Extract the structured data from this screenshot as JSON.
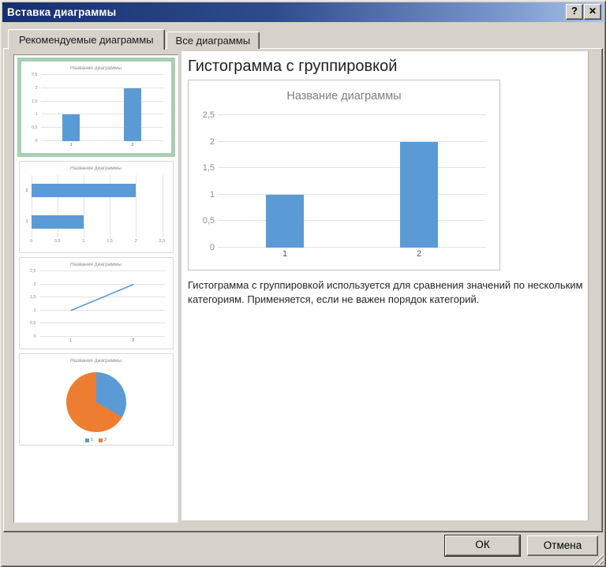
{
  "window": {
    "title": "Вставка диаграммы",
    "help_glyph": "?",
    "close_glyph": "✕"
  },
  "tabs": [
    {
      "id": "recommended",
      "label": "Рекомендуемые диаграммы",
      "active": true
    },
    {
      "id": "all",
      "label": "Все диаграммы",
      "active": false
    }
  ],
  "main": {
    "heading": "Гистограмма с группировкой",
    "description": "Гистограмма с группировкой используется для сравнения значений по нескольким категориям. Применяется, если не важен порядок категорий."
  },
  "footer": {
    "ok": "ОК",
    "cancel": "Отмена"
  },
  "colors": {
    "bar_blue": "#5B9BD5",
    "pie_orange": "#ED7D31",
    "selection_green": "#A6CFB4"
  },
  "chart_data": [
    {
      "id": "preview",
      "type": "bar",
      "title": "Название диаграммы",
      "categories": [
        "1",
        "2"
      ],
      "values": [
        1,
        2
      ],
      "ylim": [
        0,
        2.5
      ],
      "yticks": [
        "0",
        "0,5",
        "1",
        "1,5",
        "2",
        "2,5"
      ],
      "grid": true,
      "bar_color": "#5B9BD5"
    },
    {
      "id": "thumb-column",
      "type": "bar",
      "title": "Название диаграммы",
      "categories": [
        "1",
        "2"
      ],
      "values": [
        1,
        2
      ],
      "ylim": [
        0,
        2.5
      ],
      "yticks": [
        "0",
        "0,5",
        "1",
        "1,5",
        "2",
        "2,5"
      ],
      "grid": true,
      "bar_color": "#5B9BD5"
    },
    {
      "id": "thumb-bar",
      "type": "bar-horizontal",
      "title": "Название диаграммы",
      "categories": [
        "1",
        "2"
      ],
      "values": [
        1,
        2
      ],
      "xlim": [
        0,
        2.5
      ],
      "xticks": [
        "0",
        "0,5",
        "1",
        "1,5",
        "2",
        "2,5"
      ],
      "grid": true,
      "bar_color": "#5B9BD5"
    },
    {
      "id": "thumb-line",
      "type": "line",
      "title": "Название диаграммы",
      "categories": [
        "1",
        "2"
      ],
      "values": [
        1,
        2
      ],
      "ylim": [
        0,
        2.5
      ],
      "yticks": [
        "0",
        "0,5",
        "1",
        "1,5",
        "2",
        "2,5"
      ],
      "grid": true,
      "line_color": "#5B9BD5"
    },
    {
      "id": "thumb-pie",
      "type": "pie",
      "title": "Название диаграммы",
      "labels": [
        "1",
        "2"
      ],
      "values": [
        1,
        2
      ],
      "colors": [
        "#5B9BD5",
        "#ED7D31"
      ],
      "legend_position": "bottom"
    }
  ]
}
